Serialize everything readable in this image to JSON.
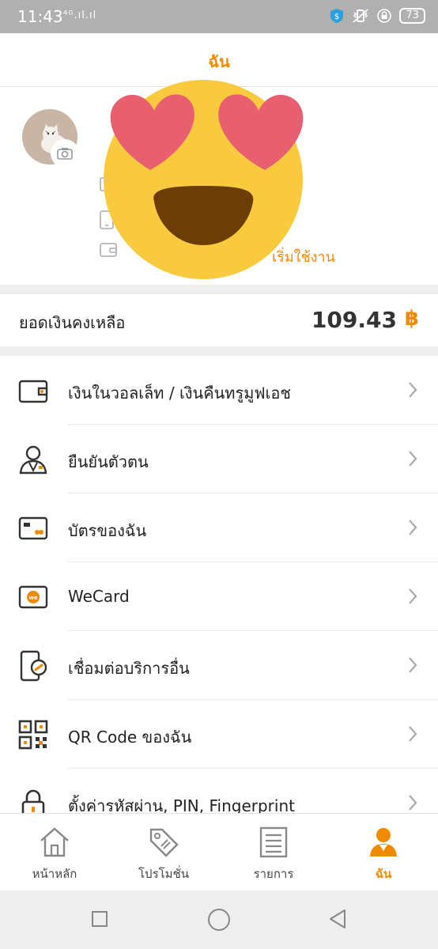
{
  "status_bar": {
    "time": "11:43",
    "signal": "⁴ᴳ.ıl.ıl",
    "battery": "73"
  },
  "header": {
    "title": "ฉัน"
  },
  "profile": {
    "start_link": "เริ่มใช้งาน"
  },
  "balance": {
    "label": "ยอดเงินคงเหลือ",
    "amount": "109.43",
    "currency": "฿"
  },
  "menu": {
    "items": [
      {
        "label": "เงินในวอลเล็ท / เงินคืนทรูมูฟเอช",
        "icon": "wallet-icon"
      },
      {
        "label": "ยืนยันตัวตน",
        "icon": "identity-icon"
      },
      {
        "label": "บัตรของฉัน",
        "icon": "card-icon"
      },
      {
        "label": "WeCard",
        "icon": "wecard-icon"
      },
      {
        "label": "เชื่อมต่อบริการอื่น",
        "icon": "link-service-icon"
      },
      {
        "label": "QR Code ของฉัน",
        "icon": "qr-code-icon"
      },
      {
        "label": "ตั้งค่ารหัสผ่าน, PIN, Fingerprint",
        "icon": "lock-icon"
      }
    ]
  },
  "bottom_nav": {
    "items": [
      {
        "label": "หน้าหลัก",
        "icon": "home-icon"
      },
      {
        "label": "โปรโมชั่น",
        "icon": "tag-icon"
      },
      {
        "label": "รายการ",
        "icon": "list-icon"
      },
      {
        "label": "ฉัน",
        "icon": "user-icon",
        "active": true
      }
    ]
  },
  "colors": {
    "accent": "#f08a00",
    "text": "#222222",
    "muted": "#999999",
    "separator": "#eeeeee"
  }
}
